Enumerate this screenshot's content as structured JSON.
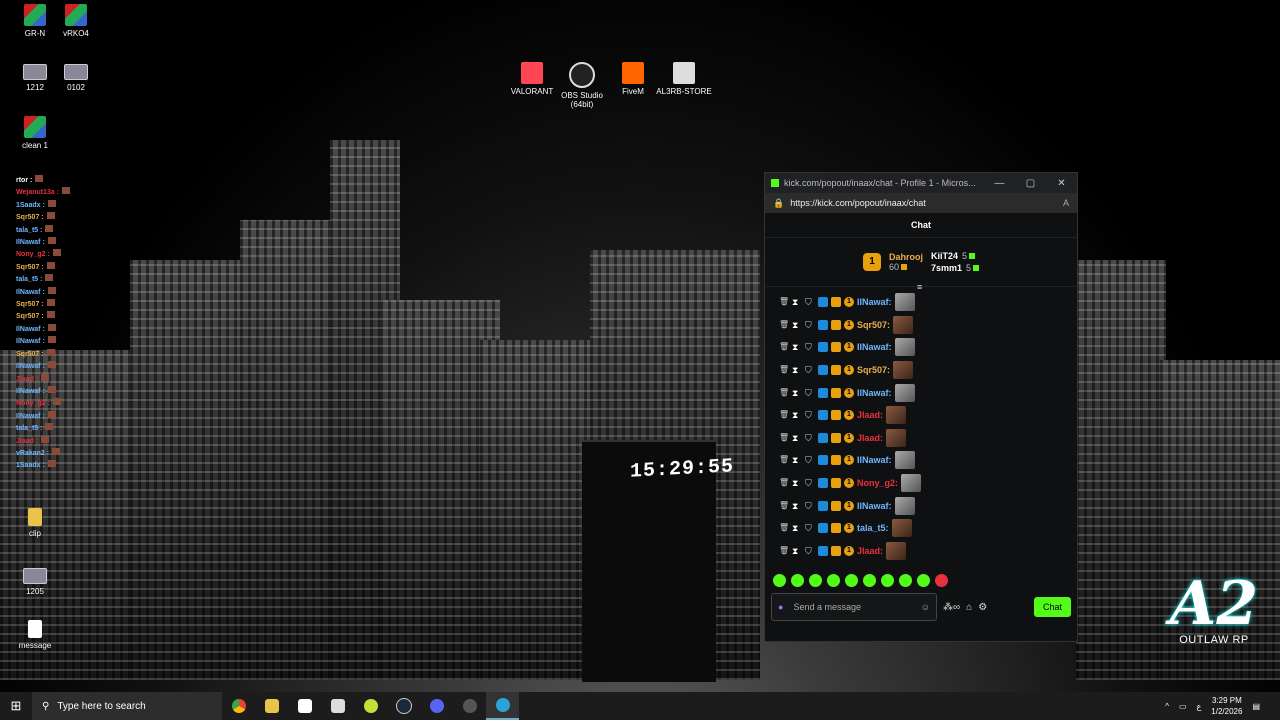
{
  "desktop": {
    "icons_left": [
      {
        "label": "GR-N",
        "icon": "winrar-icon"
      },
      {
        "label": "vRKO4",
        "icon": "winrar-icon"
      },
      {
        "label": "1212",
        "icon": "image-icon"
      },
      {
        "label": "0102",
        "icon": "image-icon"
      },
      {
        "label": "clean 1",
        "icon": "winrar-icon"
      },
      {
        "label": "clip",
        "icon": "folder-icon"
      },
      {
        "label": "1205",
        "icon": "image-icon"
      },
      {
        "label": "message",
        "icon": "document-icon"
      }
    ],
    "icons_top": [
      {
        "label": "VALORANT",
        "icon": "valorant-icon"
      },
      {
        "label": "OBS Studio (64bit)",
        "icon": "obs-icon"
      },
      {
        "label": "FiveM",
        "icon": "fivem-icon"
      },
      {
        "label": "AL3RB-STORE",
        "icon": "store-icon"
      }
    ],
    "wallpaper_clock": "15:29:55",
    "logo_text": "OUTLAW RP"
  },
  "overlay_chat": [
    {
      "user": "rtor :",
      "color": "#ffffff"
    },
    {
      "user": "Wejanut13a :",
      "color": "#e8313d"
    },
    {
      "user": "1Saadx :",
      "color": "#6fb8ff"
    },
    {
      "user": "Sqr507 :",
      "color": "#e8b04a"
    },
    {
      "user": "tala_t5 :",
      "color": "#6fb8ff"
    },
    {
      "user": "IlNawaf :",
      "color": "#6fb8ff"
    },
    {
      "user": "Nony_g2 :",
      "color": "#e8313d"
    },
    {
      "user": "Sqr507 :",
      "color": "#e8b04a"
    },
    {
      "user": "tala_t5 :",
      "color": "#6fb8ff"
    },
    {
      "user": "IlNawaf :",
      "color": "#6fb8ff"
    },
    {
      "user": "Sqr507 :",
      "color": "#e8b04a"
    },
    {
      "user": "Sqr507 :",
      "color": "#e8b04a"
    },
    {
      "user": "IlNawaf :",
      "color": "#6fb8ff"
    },
    {
      "user": "IlNawaf :",
      "color": "#6fb8ff"
    },
    {
      "user": "Sqr507 :",
      "color": "#e8b04a"
    },
    {
      "user": "IlNawaf :",
      "color": "#6fb8ff"
    },
    {
      "user": "Jlaad :",
      "color": "#e8313d"
    },
    {
      "user": "IlNawaf :",
      "color": "#6fb8ff"
    },
    {
      "user": "Nony_g2 :",
      "color": "#e8313d"
    },
    {
      "user": "IlNawaf :",
      "color": "#6fb8ff"
    },
    {
      "user": "tala_t5 :",
      "color": "#6fb8ff"
    },
    {
      "user": "Jlaad :",
      "color": "#e8313d"
    },
    {
      "user": "vRakan2 :",
      "color": "#6fb8ff"
    },
    {
      "user": "1Saadx :",
      "color": "#6fb8ff"
    }
  ],
  "browser": {
    "title": "kick.com/popout/inaax/chat - Profile 1 - Micros...",
    "url": "https://kick.com/popout/inaax/chat",
    "chat_header": "Chat",
    "leaderboard": {
      "first": {
        "rank": "1",
        "name": "Dahrooj",
        "count": "60"
      },
      "others": [
        {
          "name": "KiiT24",
          "count": "5"
        },
        {
          "name": "7smm1",
          "count": "5"
        }
      ]
    },
    "messages": [
      {
        "user": "IlNawaf:",
        "color": "#6fb8ff",
        "emote": "g"
      },
      {
        "user": "Sqr507:",
        "color": "#e8b04a",
        "emote": "b"
      },
      {
        "user": "IlNawaf:",
        "color": "#6fb8ff",
        "emote": "g"
      },
      {
        "user": "Sqr507:",
        "color": "#e8b04a",
        "emote": "b"
      },
      {
        "user": "IlNawaf:",
        "color": "#6fb8ff",
        "emote": "g"
      },
      {
        "user": "Jlaad:",
        "color": "#e8313d",
        "emote": "b"
      },
      {
        "user": "Jlaad:",
        "color": "#e8313d",
        "emote": "b"
      },
      {
        "user": "IlNawaf:",
        "color": "#6fb8ff",
        "emote": "g"
      },
      {
        "user": "Nony_g2:",
        "color": "#e8313d",
        "emote": "g"
      },
      {
        "user": "IlNawaf:",
        "color": "#6fb8ff",
        "emote": "g"
      },
      {
        "user": "tala_t5:",
        "color": "#6fb8ff",
        "emote": "b"
      },
      {
        "user": "Jlaad:",
        "color": "#e8313d",
        "emote": "b"
      }
    ],
    "input_placeholder": "Send a message",
    "chat_button": "Chat"
  },
  "taskbar": {
    "search_placeholder": "Type here to search",
    "time": "3:29 PM",
    "date": "1/2/2026",
    "lang": "ع"
  }
}
